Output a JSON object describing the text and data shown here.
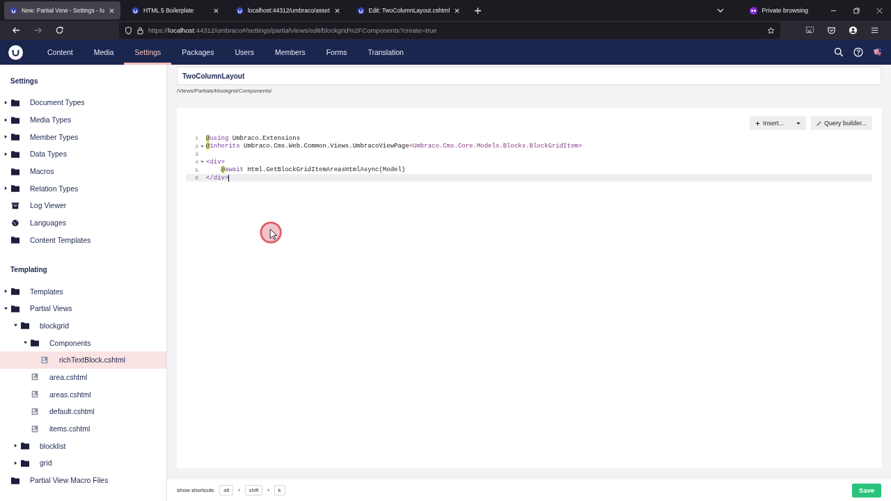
{
  "browser": {
    "tabs": [
      {
        "title": "New: Partial View - Settings - lo",
        "selected": true
      },
      {
        "title": "HTML 5 Boilerplate",
        "selected": false
      },
      {
        "title": "localhost:44312/umbraco/asset",
        "selected": false
      },
      {
        "title": "Edit: TwoColumnLayout.cshtml",
        "selected": false
      }
    ],
    "private_label": "Private browsing",
    "url_prefix": "https://",
    "url_host": "localhost",
    "url_rest": ":44312/umbraco#/settings/partialViews/edit/blockgrid%2FComponents?create=true"
  },
  "nav": {
    "items": [
      {
        "label": "Content",
        "selected": false
      },
      {
        "label": "Media",
        "selected": false
      },
      {
        "label": "Settings",
        "selected": true
      },
      {
        "label": "Packages",
        "selected": false
      },
      {
        "label": "Users",
        "selected": false
      },
      {
        "label": "Members",
        "selected": false
      },
      {
        "label": "Forms",
        "selected": false
      },
      {
        "label": "Translation",
        "selected": false
      }
    ]
  },
  "sidebar": {
    "sections": [
      {
        "title": "Settings",
        "items": [
          {
            "label": "Document Types",
            "kind": "folder",
            "expanded": false,
            "selected": false
          },
          {
            "label": "Media Types",
            "kind": "folder",
            "expanded": false,
            "selected": false
          },
          {
            "label": "Member Types",
            "kind": "folder",
            "expanded": false,
            "selected": false
          },
          {
            "label": "Data Types",
            "kind": "folder",
            "expanded": false,
            "selected": false
          },
          {
            "label": "Macros",
            "kind": "folder",
            "selected": false
          },
          {
            "label": "Relation Types",
            "kind": "folder",
            "expanded": false,
            "selected": false
          },
          {
            "label": "Log Viewer",
            "kind": "archive",
            "selected": false
          },
          {
            "label": "Languages",
            "kind": "globe",
            "selected": false
          },
          {
            "label": "Content Templates",
            "kind": "folder",
            "selected": false
          }
        ]
      },
      {
        "title": "Templating",
        "items": [
          {
            "label": "Templates",
            "kind": "folder",
            "expanded": false,
            "selected": false
          },
          {
            "label": "Partial Views",
            "kind": "folder",
            "expanded": true,
            "selected": false,
            "children": [
              {
                "label": "blockgrid",
                "kind": "folder",
                "expanded": true,
                "selected": false,
                "children": [
                  {
                    "label": "Components",
                    "kind": "folder",
                    "expanded": true,
                    "selected": false,
                    "children": [
                      {
                        "label": "richTextBlock.cshtml",
                        "kind": "file",
                        "selected": true
                      }
                    ]
                  },
                  {
                    "label": "area.cshtml",
                    "kind": "file",
                    "selected": false
                  },
                  {
                    "label": "areas.cshtml",
                    "kind": "file",
                    "selected": false
                  },
                  {
                    "label": "default.cshtml",
                    "kind": "file",
                    "selected": false
                  },
                  {
                    "label": "items.cshtml",
                    "kind": "file",
                    "selected": false
                  }
                ]
              },
              {
                "label": "blocklist",
                "kind": "folder",
                "expanded": false,
                "selected": false
              },
              {
                "label": "grid",
                "kind": "folder",
                "expanded": false,
                "selected": false
              }
            ]
          },
          {
            "label": "Partial View Macro Files",
            "kind": "folder",
            "selected": false
          }
        ]
      }
    ]
  },
  "editor": {
    "name": "TwoColumnLayout",
    "path": "/Views/Partials/blockgrid/Components/",
    "insert_button": "Insert...",
    "query_button": "Query builder...",
    "lines": [
      {
        "number": "1",
        "fold": false,
        "current": false,
        "tokens": [
          {
            "kind": "at",
            "text": "@"
          },
          {
            "kind": "keyword",
            "text": "using"
          },
          {
            "kind": "plain",
            "text": " Umbraco.Extensions"
          }
        ]
      },
      {
        "number": "2",
        "fold": true,
        "current": false,
        "tokens": [
          {
            "kind": "at",
            "text": "@"
          },
          {
            "kind": "keyword",
            "text": "inherits"
          },
          {
            "kind": "plain",
            "text": " Umbraco.Cms.Web.Common.Views.UmbracoViewPage"
          },
          {
            "kind": "type",
            "text": "<Umbraco.Cms.Core.Models.Blocks.BlockGridItem>"
          }
        ]
      },
      {
        "number": "3",
        "fold": false,
        "current": false
      },
      {
        "number": "4",
        "fold": true,
        "current": false,
        "tokens": [
          {
            "kind": "tag",
            "text": "<div>"
          }
        ],
        "children": [
          {
            "number": "5",
            "fold": false,
            "current": false,
            "tokens": [
              {
                "kind": "at",
                "text": "@"
              },
              {
                "kind": "keyword",
                "text": "await"
              },
              {
                "kind": "plain",
                "text": " Html.GetBlockGridItemAreasHtmlAsync(Model)"
              }
            ]
          }
        ]
      },
      {
        "number": "6",
        "fold": false,
        "current": true,
        "tokens": [
          {
            "kind": "tag",
            "text": "</div>"
          }
        ]
      }
    ]
  },
  "footer": {
    "shortcuts_label": "show shortcuts",
    "keys": [
      "alt",
      "shift",
      "k"
    ],
    "separator": "+",
    "save_button": "Save"
  }
}
